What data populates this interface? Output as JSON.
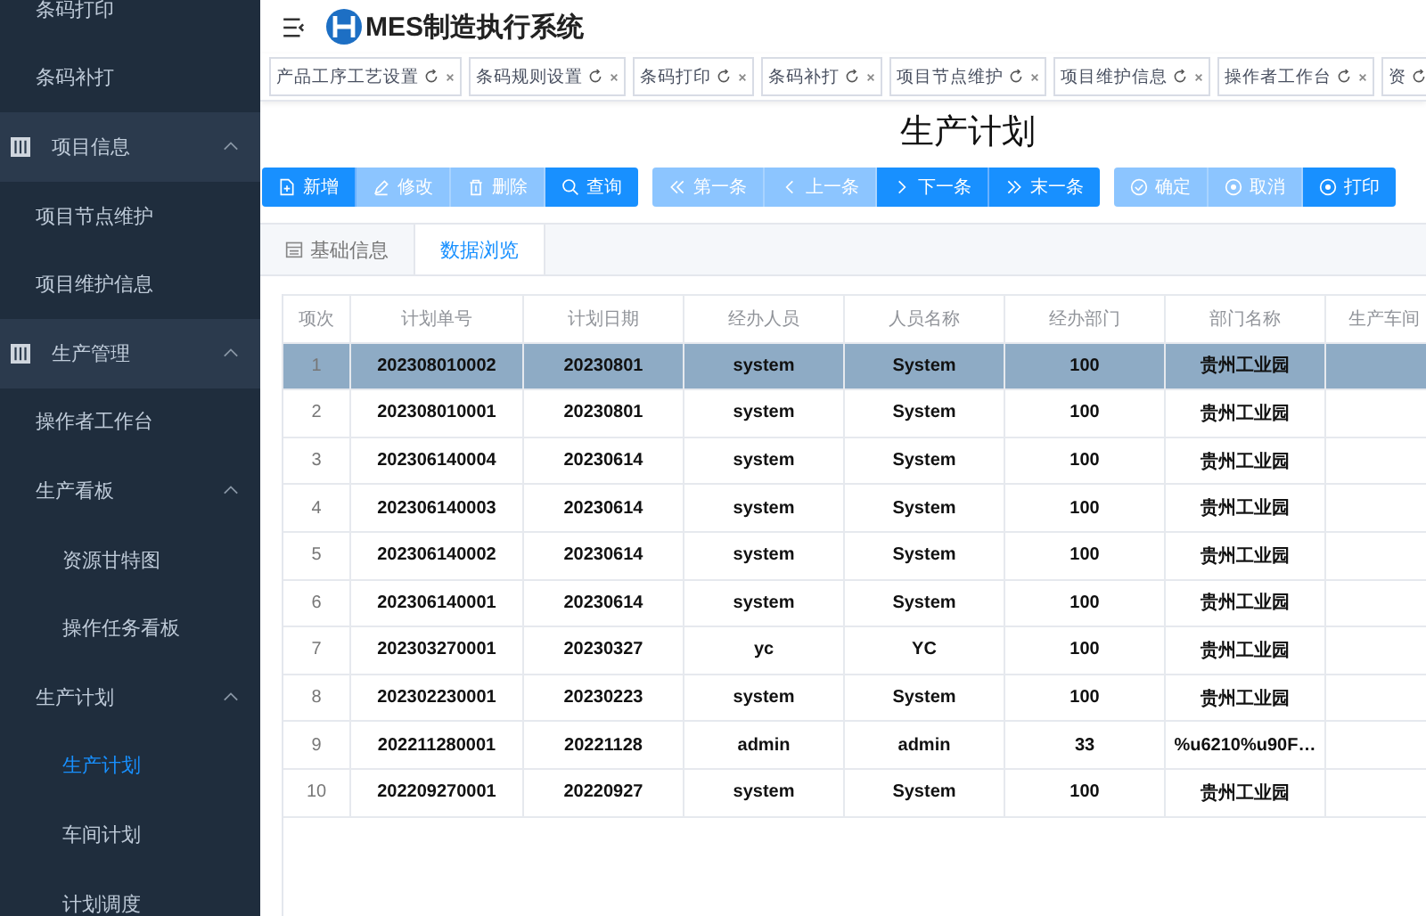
{
  "sidebar": {
    "items": [
      {
        "label": "条码打印",
        "selected": false
      },
      {
        "label": "条码补打",
        "selected": false
      },
      {
        "label": "项目信息",
        "expanded": true,
        "children": [
          {
            "label": "项目节点维护",
            "selected": false
          },
          {
            "label": "项目维护信息",
            "selected": false
          }
        ]
      },
      {
        "label": "生产管理",
        "expanded": true,
        "children": [
          {
            "label": "操作者工作台",
            "selected": false
          },
          {
            "label": "生产看板",
            "expanded": true,
            "children": [
              {
                "label": "资源甘特图",
                "selected": false
              },
              {
                "label": "操作任务看板",
                "selected": false
              }
            ]
          },
          {
            "label": "生产计划",
            "expanded": true,
            "children": [
              {
                "label": "生产计划",
                "selected": true
              },
              {
                "label": "车间计划",
                "selected": false
              },
              {
                "label": "计划调度",
                "selected": false
              }
            ]
          }
        ]
      }
    ]
  },
  "header": {
    "title": "MES制造执行系统"
  },
  "open_tabs": [
    "产品工序工艺设置",
    "条码规则设置",
    "条码打印",
    "条码补打",
    "项目节点维护",
    "项目维护信息",
    "操作者工作台",
    "资"
  ],
  "page_title": "生产计划",
  "toolbar": [
    [
      {
        "label": "新增",
        "disabled": false
      },
      {
        "label": "修改",
        "disabled": true
      },
      {
        "label": "删除",
        "disabled": true
      },
      {
        "label": "查询",
        "disabled": false
      }
    ],
    [
      {
        "label": "第一条",
        "disabled": true
      },
      {
        "label": "上一条",
        "disabled": true
      },
      {
        "label": "下一条",
        "disabled": false
      },
      {
        "label": "末一条",
        "disabled": false
      }
    ],
    [
      {
        "label": "确定",
        "disabled": true
      },
      {
        "label": "取消",
        "disabled": true
      },
      {
        "label": "打印",
        "disabled": false
      }
    ]
  ],
  "view_tabs": [
    {
      "label": "基础信息",
      "selected": false
    },
    {
      "label": "数据浏览",
      "selected": true
    }
  ],
  "table": {
    "columns": [
      "项次",
      "计划单号",
      "计划日期",
      "经办人员",
      "人员名称",
      "经办部门",
      "部门名称",
      "生产车间"
    ],
    "rows": [
      {
        "selected": true,
        "cells": [
          "1",
          "202308010002",
          "20230801",
          "system",
          "System",
          "100",
          "贵州工业园"
        ]
      },
      {
        "selected": false,
        "cells": [
          "2",
          "202308010001",
          "20230801",
          "system",
          "System",
          "100",
          "贵州工业园"
        ]
      },
      {
        "selected": false,
        "cells": [
          "3",
          "202306140004",
          "20230614",
          "system",
          "System",
          "100",
          "贵州工业园"
        ]
      },
      {
        "selected": false,
        "cells": [
          "4",
          "202306140003",
          "20230614",
          "system",
          "System",
          "100",
          "贵州工业园"
        ]
      },
      {
        "selected": false,
        "cells": [
          "5",
          "202306140002",
          "20230614",
          "system",
          "System",
          "100",
          "贵州工业园"
        ]
      },
      {
        "selected": false,
        "cells": [
          "6",
          "202306140001",
          "20230614",
          "system",
          "System",
          "100",
          "贵州工业园"
        ]
      },
      {
        "selected": false,
        "cells": [
          "7",
          "202303270001",
          "20230327",
          "yc",
          "YC",
          "100",
          "贵州工业园"
        ]
      },
      {
        "selected": false,
        "cells": [
          "8",
          "202302230001",
          "20230223",
          "system",
          "System",
          "100",
          "贵州工业园"
        ]
      },
      {
        "selected": false,
        "cells": [
          "9",
          "202211280001",
          "20221128",
          "admin",
          "admin",
          "33",
          "%u6210%u90F…"
        ]
      },
      {
        "selected": false,
        "cells": [
          "10",
          "202209270001",
          "20220927",
          "system",
          "System",
          "100",
          "贵州工业园"
        ]
      }
    ]
  }
}
